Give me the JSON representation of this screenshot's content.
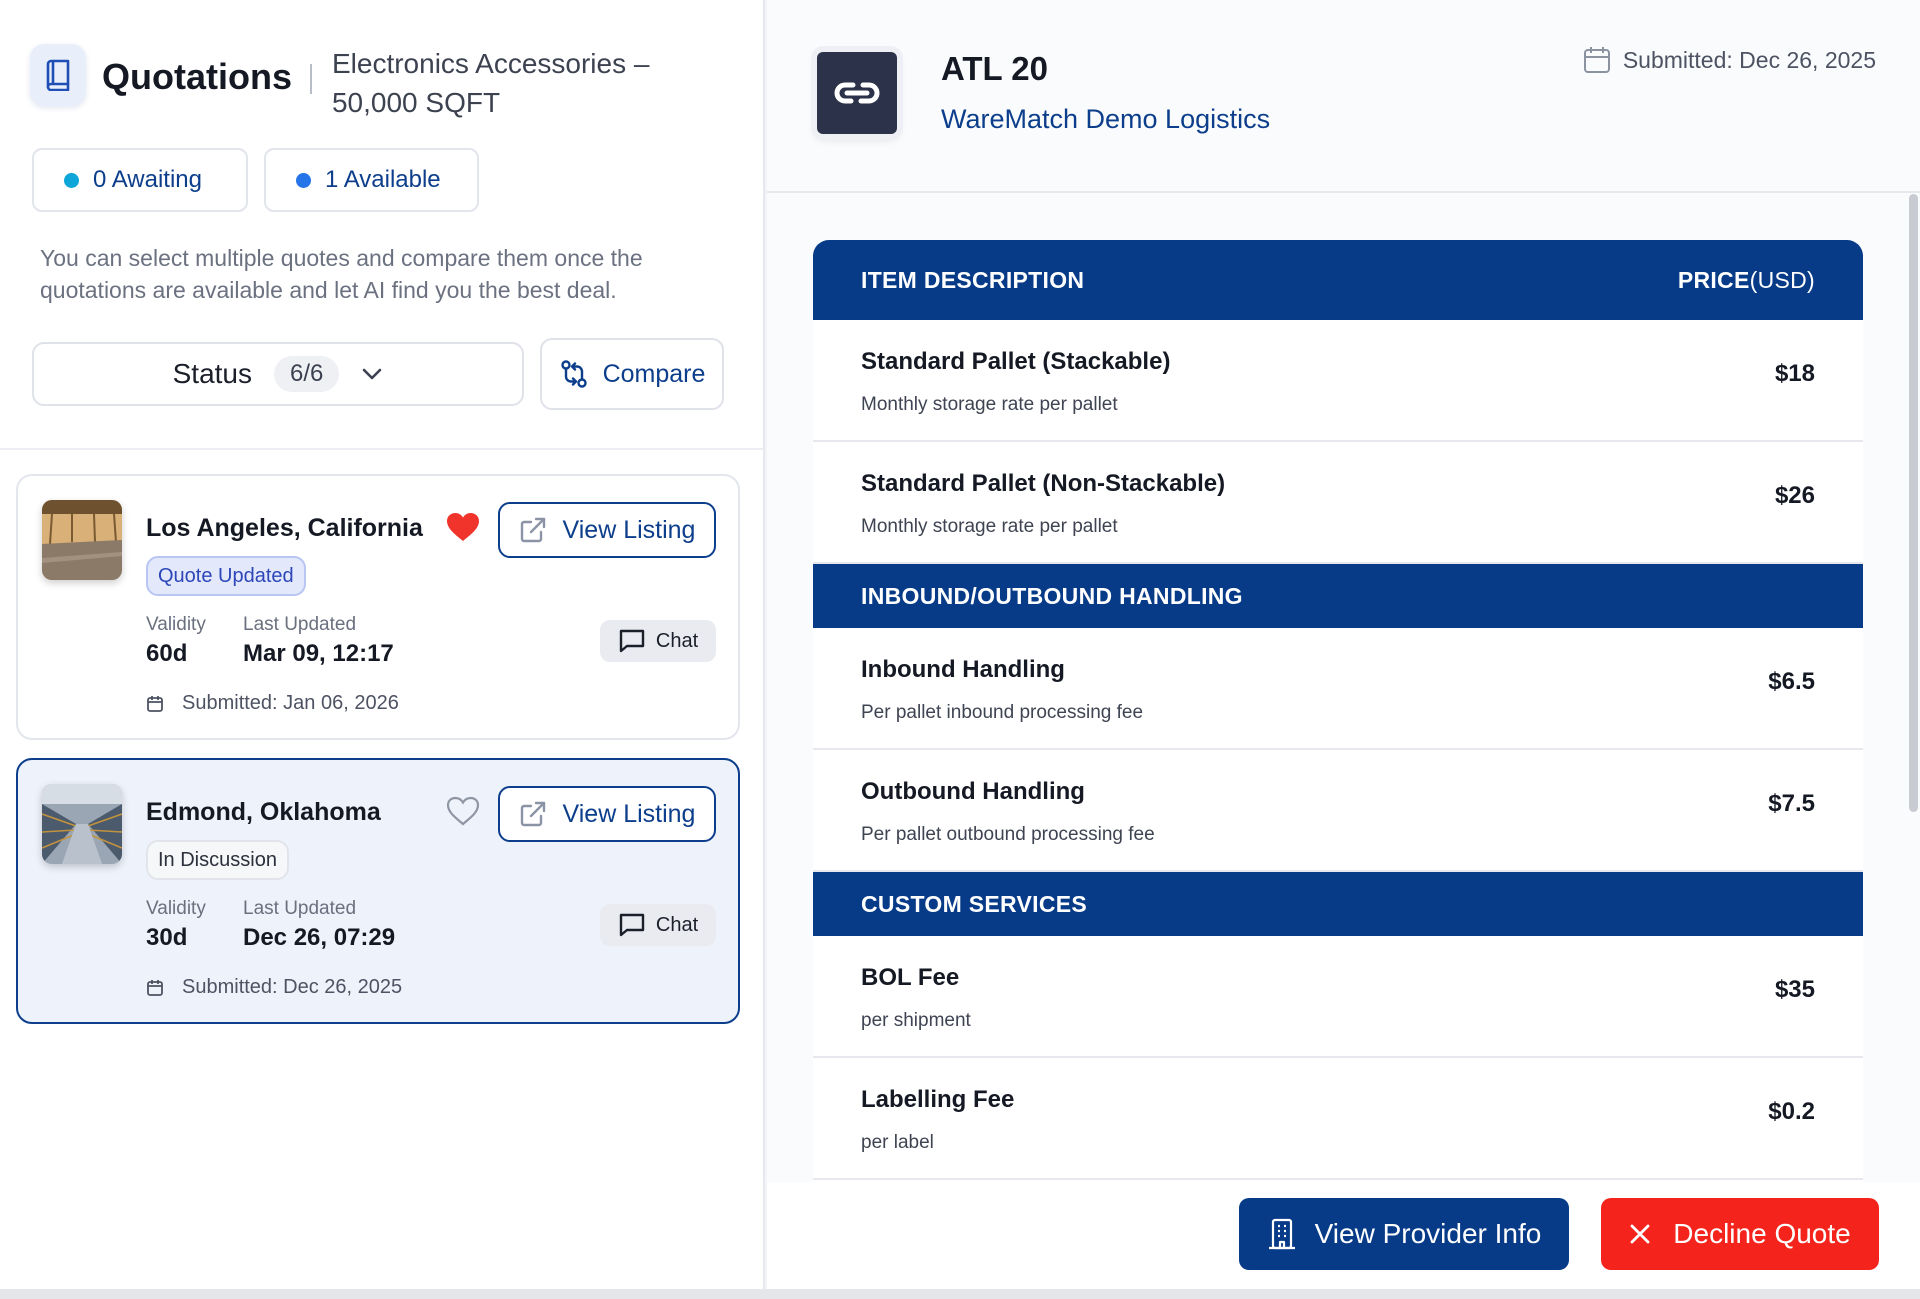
{
  "sidebar": {
    "title": "Quotations",
    "subtitle": "Electronics Accessories – 50,000 SQFT",
    "pills": {
      "awaiting": "0 Awaiting",
      "available": "1 Available",
      "awaiting_color": "#0ea5d8",
      "available_color": "#2575e8"
    },
    "helper_text": "You can select multiple quotes and compare them once the quotations are available and let AI find you the best deal.",
    "status_filter": {
      "label": "Status",
      "count": "6/6"
    },
    "compare_label": "Compare"
  },
  "quotes": [
    {
      "city": "Los Angeles, California",
      "favorite": true,
      "view_label": "View Listing",
      "badge": "Quote Updated",
      "validity_label": "Validity",
      "validity": "60d",
      "updated_label": "Last Updated",
      "updated": "Mar 09, 12:17",
      "chat_label": "Chat",
      "submitted": "Submitted: Jan 06, 2026"
    },
    {
      "city": "Edmond, Oklahoma",
      "favorite": false,
      "view_label": "View Listing",
      "badge": "In Discussion",
      "validity_label": "Validity",
      "validity": "30d",
      "updated_label": "Last Updated",
      "updated": "Dec 26, 07:29",
      "chat_label": "Chat",
      "submitted": "Submitted: Dec 26, 2025"
    }
  ],
  "detail": {
    "provider_name": "ATL 20",
    "company": "WareMatch Demo Logistics",
    "submitted": "Submitted: Dec 26, 2025",
    "table": {
      "header_item": "ITEM DESCRIPTION",
      "header_price": "PRICE",
      "header_unit": "(USD)",
      "sections": [
        {
          "title": "",
          "rows": [
            {
              "name": "Standard Pallet (Stackable)",
              "desc": "Monthly storage rate per pallet",
              "price": "$18"
            },
            {
              "name": "Standard Pallet (Non-Stackable)",
              "desc": "Monthly storage rate per pallet",
              "price": "$26"
            }
          ]
        },
        {
          "title": "INBOUND/OUTBOUND HANDLING",
          "rows": [
            {
              "name": "Inbound Handling",
              "desc": "Per pallet inbound processing fee",
              "price": "$6.5"
            },
            {
              "name": "Outbound Handling",
              "desc": "Per pallet outbound processing fee",
              "price": "$7.5"
            }
          ]
        },
        {
          "title": "CUSTOM SERVICES",
          "rows": [
            {
              "name": "BOL Fee",
              "desc": "per shipment",
              "price": "$35"
            },
            {
              "name": "Labelling Fee",
              "desc": "per label",
              "price": "$0.2"
            }
          ]
        }
      ]
    },
    "actions": {
      "provider_info": "View Provider Info",
      "decline": "Decline Quote"
    }
  },
  "colors": {
    "brand_navy": "#073b88",
    "danger": "#f4231b",
    "heart_filled": "#f0342b"
  }
}
